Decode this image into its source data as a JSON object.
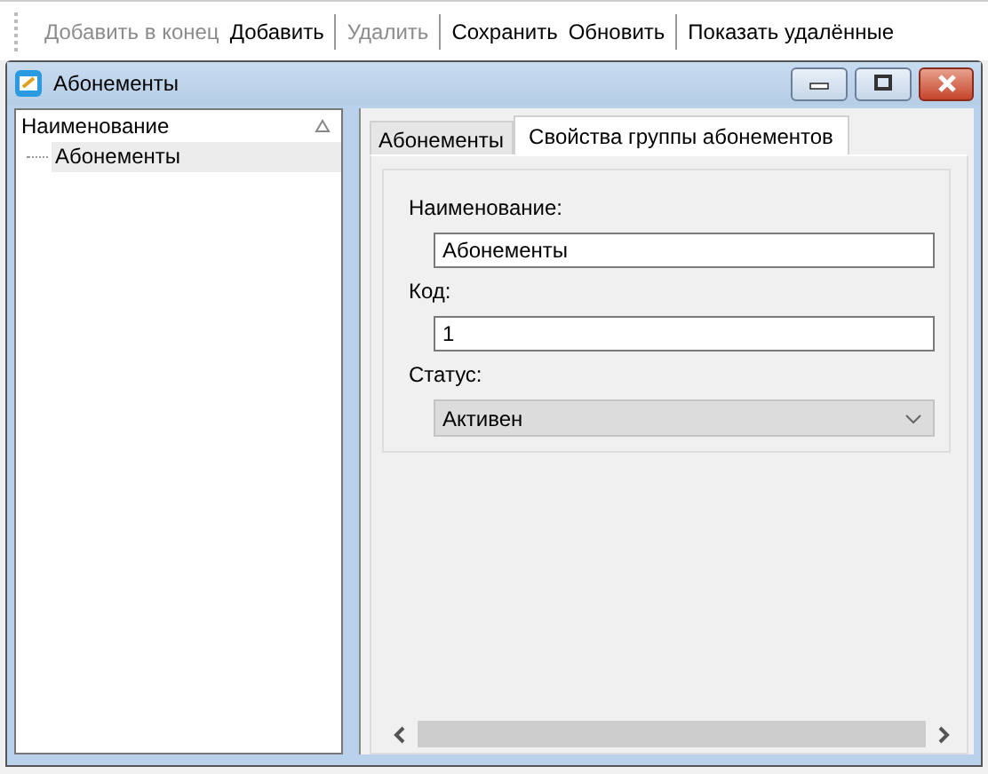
{
  "toolbar": [
    {
      "label": "Добавить в конец",
      "disabled": true,
      "separator_after": false
    },
    {
      "label": "Добавить",
      "disabled": false,
      "separator_after": true
    },
    {
      "label": "Удалить",
      "disabled": true,
      "separator_after": true
    },
    {
      "label": "Сохранить",
      "disabled": false,
      "separator_after": false
    },
    {
      "label": "Обновить",
      "disabled": false,
      "separator_after": true
    },
    {
      "label": "Показать удалённые",
      "disabled": false,
      "separator_after": false
    }
  ],
  "window": {
    "title": "Абонементы"
  },
  "tree": {
    "column": "Наименование",
    "items": [
      {
        "label": "Абонементы",
        "selected": true
      }
    ]
  },
  "tabs": [
    {
      "label": "Абонементы",
      "selected": false
    },
    {
      "label": "Свойства группы абонементов",
      "selected": true
    }
  ],
  "form": {
    "fields": [
      {
        "kind": "text",
        "label": "Наименование:",
        "value": "Абонементы"
      },
      {
        "kind": "text",
        "label": "Код:",
        "value": "1"
      },
      {
        "kind": "select",
        "label": "Статус:",
        "value": "Активен"
      }
    ]
  }
}
